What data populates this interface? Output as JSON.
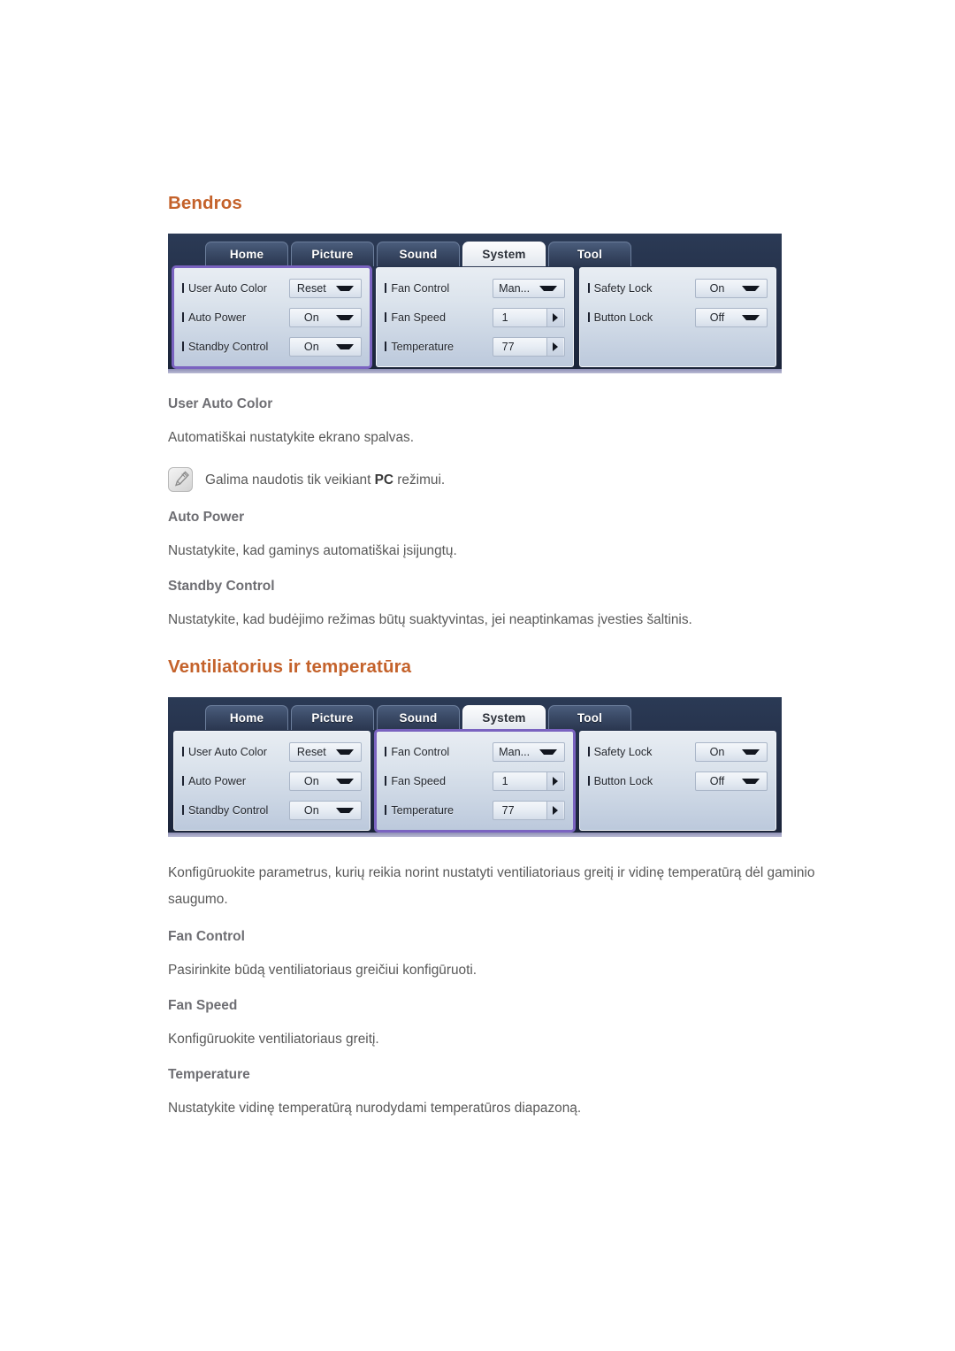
{
  "page": {
    "heading_color": "#c4622b",
    "sections": [
      {
        "id": "bendros",
        "heading": "Bendros",
        "blocks": [
          {
            "type": "subheading",
            "text": "User Auto Color"
          },
          {
            "type": "paragraph",
            "text": "Automatiškai nustatykite ekrano spalvas."
          },
          {
            "type": "note",
            "text_before": "Galima naudotis tik veikiant ",
            "text_bold": "PC",
            "text_after": " režimui."
          },
          {
            "type": "subheading",
            "text": "Auto Power"
          },
          {
            "type": "paragraph",
            "text": "Nustatykite, kad gaminys automatiškai įsijungtų."
          },
          {
            "type": "subheading",
            "text": "Standby Control"
          },
          {
            "type": "paragraph",
            "text": "Nustatykite, kad budėjimo režimas būtų suaktyvintas, jei neaptinkamas įvesties šaltinis."
          }
        ]
      },
      {
        "id": "ventiliatorius",
        "heading": "Ventiliatorius ir temperatūra",
        "blocks": [
          {
            "type": "paragraph",
            "text": "Konfigūruokite parametrus, kurių reikia norint nustatyti ventiliatoriaus greitį ir vidinę temperatūrą dėl gaminio saugumo."
          },
          {
            "type": "subheading",
            "text": "Fan Control"
          },
          {
            "type": "paragraph",
            "text": "Pasirinkite būdą ventiliatoriaus greičiui konfigūruoti."
          },
          {
            "type": "subheading",
            "text": "Fan Speed"
          },
          {
            "type": "paragraph",
            "text": "Konfigūruokite ventiliatoriaus greitį."
          },
          {
            "type": "subheading",
            "text": "Temperature"
          },
          {
            "type": "paragraph",
            "text": "Nustatykite vidinę temperatūrą nurodydami temperatūros diapazoną."
          }
        ]
      }
    ]
  },
  "osd": {
    "highlight_color": "#7a63c0",
    "tabs": [
      {
        "label": "Home",
        "active": false
      },
      {
        "label": "Picture",
        "active": false
      },
      {
        "label": "Sound",
        "active": false
      },
      {
        "label": "System",
        "active": true
      },
      {
        "label": "Tool",
        "active": false
      }
    ],
    "panels": [
      {
        "name": "general-panel",
        "rows": [
          {
            "label": "User Auto Color",
            "value": "Reset",
            "control": "dropdown"
          },
          {
            "label": "Auto Power",
            "value": "On",
            "control": "dropdown"
          },
          {
            "label": "Standby Control",
            "value": "On",
            "control": "dropdown"
          }
        ]
      },
      {
        "name": "fan-temperature-panel",
        "rows": [
          {
            "label": "Fan Control",
            "value": "Man...",
            "control": "dropdown"
          },
          {
            "label": "Fan Speed",
            "value": "1",
            "control": "spinner"
          },
          {
            "label": "Temperature",
            "value": "77",
            "control": "spinner"
          }
        ]
      },
      {
        "name": "lock-panel",
        "rows": [
          {
            "label": "Safety Lock",
            "value": "On",
            "control": "dropdown"
          },
          {
            "label": "Button Lock",
            "value": "Off",
            "control": "dropdown"
          }
        ]
      }
    ],
    "instances": [
      {
        "id": "osd-general",
        "highlight_panel_index": 0
      },
      {
        "id": "osd-fan",
        "highlight_panel_index": 1
      }
    ]
  }
}
